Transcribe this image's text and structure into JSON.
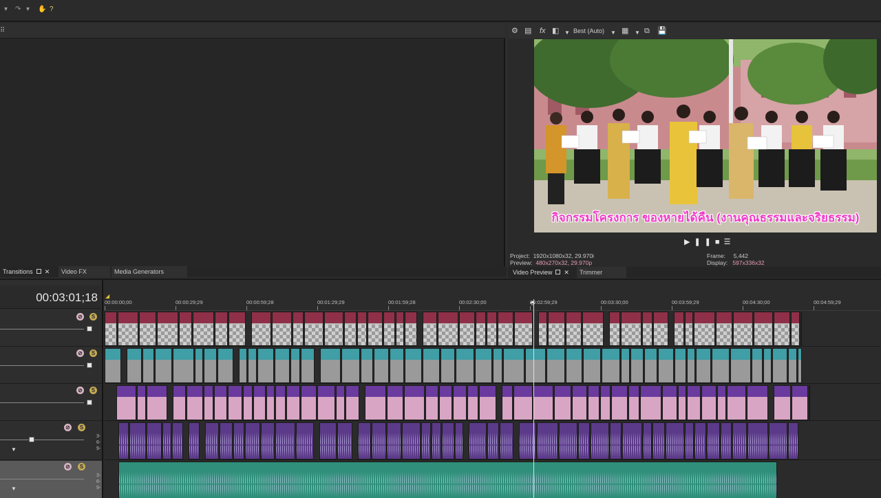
{
  "toolbar": {
    "icons": [
      "dropdown-icon",
      "redo-icon",
      "dropdown-icon",
      "help-icon",
      "whats-this-icon"
    ]
  },
  "left_tabs": [
    {
      "label": "Transitions",
      "active": true
    },
    {
      "label": "Video FX",
      "active": false
    },
    {
      "label": "Media Generators",
      "active": false
    }
  ],
  "preview": {
    "quality": "Best (Auto)",
    "caption": "กิจกรรมโครงการ ของหายได้คืน (งานคุณธรรมและจริยธรรม)",
    "project_label": "Project:",
    "project_value": "1920x1080x32, 29.970i",
    "preview_label": "Preview:",
    "preview_value": "480x270x32, 29.970p",
    "frame_label": "Frame:",
    "frame_value": "5,442",
    "display_label": "Display:",
    "display_value": "597x336x32"
  },
  "right_tabs": [
    {
      "label": "Video Preview",
      "active": true
    },
    {
      "label": "Trimmer",
      "active": false
    }
  ],
  "timeline": {
    "timecode": "00:03:01;18",
    "ruler": [
      "00:00:00;00",
      "00:00:29;29",
      "00:00:59;28",
      "00:01:29;29",
      "00:01:59;28",
      "00:02:30;00",
      "00:02:59;29",
      "00:03:30;00",
      "00:03:59;29",
      "00:04:30;00",
      "00:04:59;29"
    ],
    "meter_labels": [
      "3-",
      "6-",
      "9-"
    ]
  },
  "colors": {
    "clip_red": "#8f3048",
    "clip_teal": "#3f9ea6",
    "clip_purple": "#6a3a9e",
    "audio_purple": "#5c3a8a",
    "audio_green": "#2f8f7a"
  }
}
